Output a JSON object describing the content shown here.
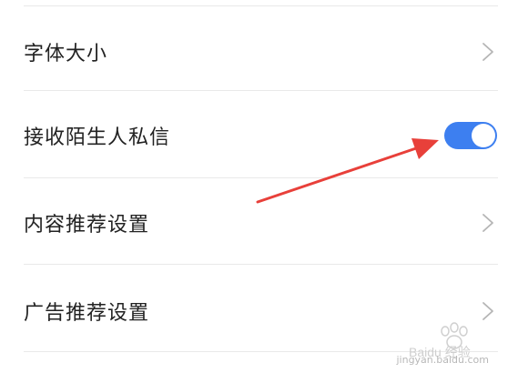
{
  "settings": {
    "items": [
      {
        "label": "字体大小",
        "control": "chevron"
      },
      {
        "label": "接收陌生人私信",
        "control": "toggle",
        "toggle_state": "on"
      },
      {
        "label": "内容推荐设置",
        "control": "chevron"
      },
      {
        "label": "广告推荐设置",
        "control": "chevron"
      }
    ]
  },
  "colors": {
    "toggle_on": "#3d7ff0",
    "arrow": "#e8403a",
    "divider": "#e9e9e9",
    "text": "#222222",
    "chevron": "#b5b5b5"
  },
  "watermark": {
    "brand": "Baidu 经验",
    "url": "jingyan.baidu.com"
  },
  "icons": {
    "chevron": "chevron-right-icon",
    "toggle_knob": "toggle-knob"
  }
}
